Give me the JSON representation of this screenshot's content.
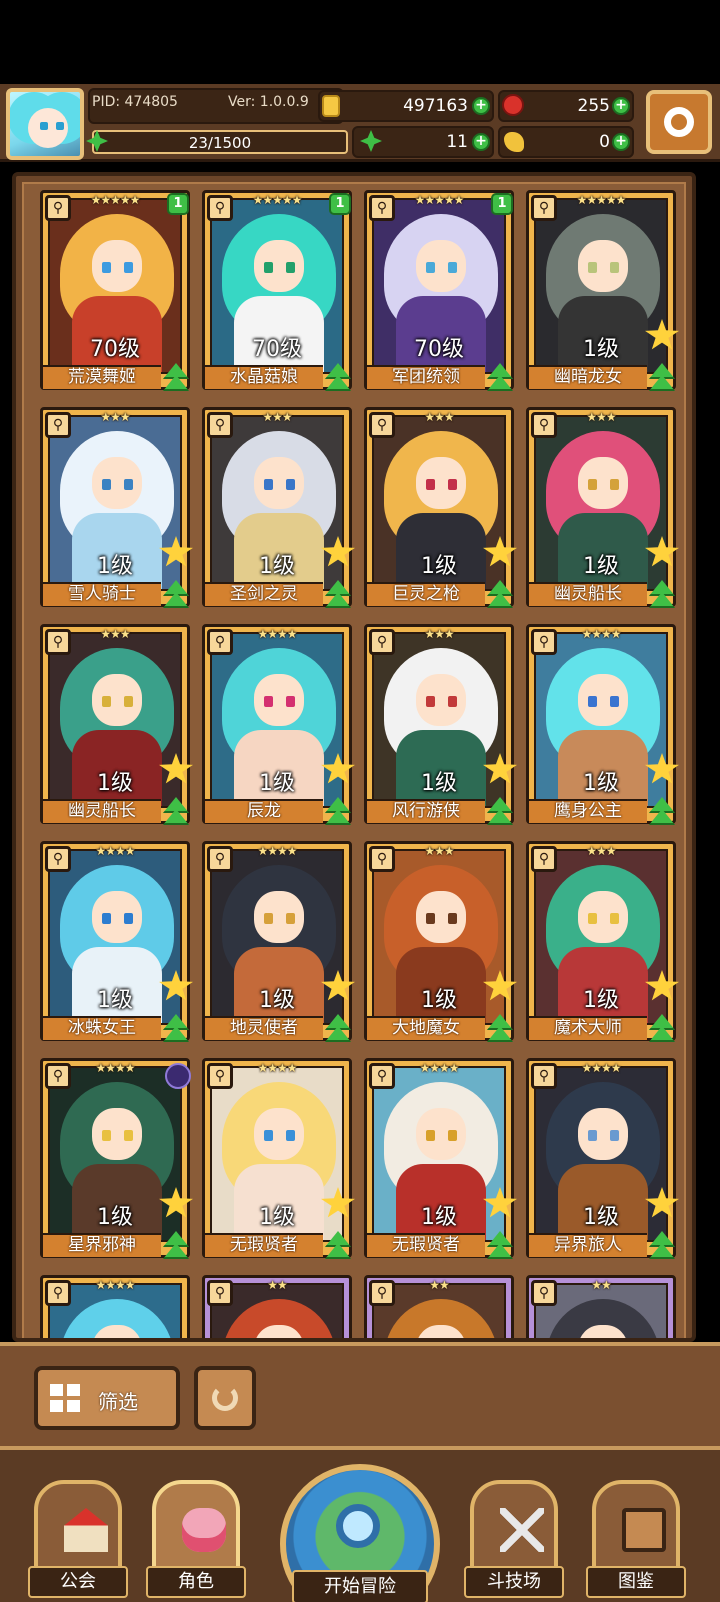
{
  "header": {
    "pid": "PID: 474805",
    "version": "Ver: 1.0.0.9",
    "gold": "497163",
    "apples": "255",
    "clovers": "11",
    "horns": "0",
    "exp": "23/1500"
  },
  "cards": [
    {
      "name": "荒漠舞姬",
      "level": "70级",
      "stars": "★★★★★",
      "badge": "1",
      "hair": "#f2b347",
      "body": "#c8402a",
      "eyes": "#3d9be0",
      "bg": "#6a2f1c",
      "frame": "gold",
      "big_star": false
    },
    {
      "name": "水晶菇娘",
      "level": "70级",
      "stars": "★★★★★",
      "badge": "1",
      "hair": "#37d7c4",
      "body": "#f4f4f4",
      "eyes": "#23a06b",
      "bg": "#2b6a86",
      "frame": "gold",
      "big_star": false
    },
    {
      "name": "军团统领",
      "level": "70级",
      "stars": "★★★★★",
      "badge": "1",
      "hair": "#d7d3f2",
      "body": "#5b3d8f",
      "eyes": "#4aa9d8",
      "bg": "#3f2e66",
      "frame": "gold",
      "big_star": false
    },
    {
      "name": "幽暗龙女",
      "level": "1级",
      "stars": "★★★★★",
      "badge": "",
      "hair": "#6f7a73",
      "body": "#343434",
      "eyes": "#b9c47a",
      "bg": "#2a2a2e",
      "frame": "gold",
      "big_star": true
    },
    {
      "name": "雪人骑士",
      "level": "1级",
      "stars": "★★★",
      "badge": "",
      "hair": "#eaf3fb",
      "body": "#a9d6ee",
      "eyes": "#3b82c2",
      "bg": "#4a6c94",
      "frame": "gold",
      "big_star": true
    },
    {
      "name": "圣剑之灵",
      "level": "1级",
      "stars": "★★★",
      "badge": "",
      "hair": "#d8dce6",
      "body": "#e3cc8c",
      "eyes": "#3a76c8",
      "bg": "#3e3a3a",
      "frame": "gold",
      "big_star": true
    },
    {
      "name": "巨灵之枪",
      "level": "1级",
      "stars": "★★★",
      "badge": "",
      "hair": "#f0b64c",
      "body": "#2e2e36",
      "eyes": "#c3304a",
      "bg": "#4a3226",
      "frame": "gold",
      "big_star": true
    },
    {
      "name": "幽灵船长",
      "level": "1级",
      "stars": "★★★",
      "badge": "",
      "hair": "#e0507a",
      "body": "#2f5a4a",
      "eyes": "#d4a23a",
      "bg": "#2c3b33",
      "frame": "gold",
      "big_star": true
    },
    {
      "name": "幽灵船长",
      "level": "1级",
      "stars": "★★★",
      "badge": "",
      "hair": "#3aa08a",
      "body": "#8a2424",
      "eyes": "#d8b03a",
      "bg": "#3a2a2a",
      "frame": "gold",
      "big_star": true
    },
    {
      "name": "辰龙",
      "level": "1级",
      "stars": "★★★★",
      "badge": "",
      "hair": "#4fd4d8",
      "body": "#f6d6c2",
      "eyes": "#d43070",
      "bg": "#2e6c88",
      "frame": "gold",
      "big_star": true
    },
    {
      "name": "风行游侠",
      "level": "1级",
      "stars": "★★★",
      "badge": "",
      "hair": "#f2f2f2",
      "body": "#2d6b54",
      "eyes": "#c23a3a",
      "bg": "#3e3426",
      "frame": "gold",
      "big_star": true
    },
    {
      "name": "鹰身公主",
      "level": "1级",
      "stars": "★★★★",
      "badge": "",
      "hair": "#62e2ea",
      "body": "#c88a5a",
      "eyes": "#3a74d0",
      "bg": "#3f7d9e",
      "frame": "gold",
      "big_star": true
    },
    {
      "name": "冰蛛女王",
      "level": "1级",
      "stars": "★★★★",
      "badge": "",
      "hair": "#5fcbe8",
      "body": "#e8f2f8",
      "eyes": "#2d7dd0",
      "bg": "#2d5c7c",
      "frame": "gold",
      "big_star": true
    },
    {
      "name": "地灵使者",
      "level": "1级",
      "stars": "★★★★",
      "badge": "",
      "hair": "#2f3440",
      "body": "#c46a3a",
      "eyes": "#d6a03a",
      "bg": "#2c2a30",
      "frame": "gold",
      "big_star": true
    },
    {
      "name": "大地魔女",
      "level": "1级",
      "stars": "★★★",
      "badge": "",
      "hair": "#c8602a",
      "body": "#8a3a1e",
      "eyes": "#6a3a1e",
      "bg": "#a85a2a",
      "frame": "gold",
      "big_star": true
    },
    {
      "name": "魔术大师",
      "level": "1级",
      "stars": "★★★",
      "badge": "",
      "hair": "#3ab08a",
      "body": "#b83838",
      "eyes": "#e8c040",
      "bg": "#5a3030",
      "frame": "gold",
      "big_star": true
    },
    {
      "name": "星界邪神",
      "level": "1级",
      "stars": "★★★★",
      "badge": "orb",
      "hair": "#2f6a52",
      "body": "#5a3a2a",
      "eyes": "#e8c040",
      "bg": "#1c2e26",
      "frame": "gold",
      "big_star": true
    },
    {
      "name": "无瑕贤者",
      "level": "1级",
      "stars": "★★★★",
      "badge": "",
      "hair": "#f8d878",
      "body": "#f6e0d0",
      "eyes": "#3a90d8",
      "bg": "#e8dcc8",
      "frame": "gold",
      "big_star": true
    },
    {
      "name": "无瑕贤者",
      "level": "1级",
      "stars": "★★★★",
      "badge": "",
      "hair": "#f2ece2",
      "body": "#b8302a",
      "eyes": "#d8a02a",
      "bg": "#6ab0c8",
      "frame": "gold",
      "big_star": true
    },
    {
      "name": "异界旅人",
      "level": "1级",
      "stars": "★★★★",
      "badge": "",
      "hair": "#2e3a4c",
      "body": "#9a5a2a",
      "eyes": "#6a9ad0",
      "bg": "#2c2c36",
      "frame": "gold",
      "big_star": true
    },
    {
      "name": "",
      "level": "",
      "stars": "★★★★",
      "badge": "",
      "hair": "#5fd0ea",
      "body": "#8ad8f0",
      "eyes": "#3a8ad0",
      "bg": "#2d6c8c",
      "frame": "gold",
      "big_star": false
    },
    {
      "name": "",
      "level": "",
      "stars": "★★",
      "badge": "",
      "hair": "#c84a2a",
      "body": "#8a2a2a",
      "eyes": "#e8c040",
      "bg": "#3a2a2a",
      "frame": "purple",
      "big_star": false
    },
    {
      "name": "",
      "level": "",
      "stars": "★★",
      "badge": "",
      "hair": "#c8782a",
      "body": "#8a4a2a",
      "eyes": "#3a3a3a",
      "bg": "#5a3a2a",
      "frame": "purple",
      "big_star": false
    },
    {
      "name": "",
      "level": "",
      "stars": "★★",
      "badge": "",
      "hair": "#3a3a44",
      "body": "#d8d8d8",
      "eyes": "#c83a3a",
      "bg": "#6a6a7a",
      "frame": "purple",
      "big_star": false
    }
  ],
  "controls": {
    "filter_label": "筛选"
  },
  "nav": {
    "guild": "公会",
    "character": "角色",
    "adventure": "开始冒险",
    "arena": "斗技场",
    "codex": "图鉴"
  },
  "colors": {
    "frame_gold": "#f0b54c",
    "frame_purple": "#b691d8",
    "panel_brown": "#5b3b24",
    "accent_green": "#3fbf46"
  }
}
